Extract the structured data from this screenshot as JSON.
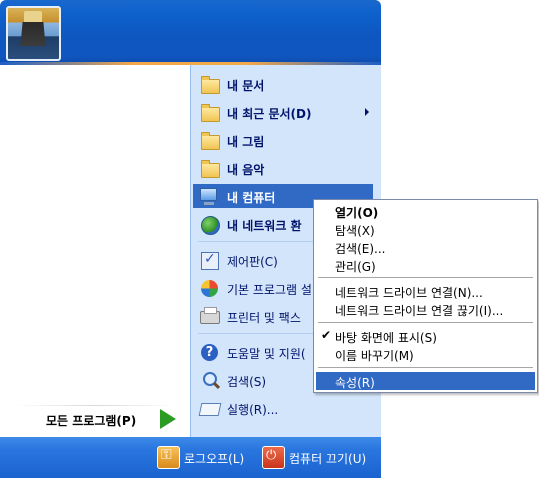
{
  "left_pane": {
    "all_programs_label": "모든 프로그램(P)"
  },
  "right_pane": {
    "items": [
      {
        "label": "내 문서",
        "icon": "folder-documents-icon"
      },
      {
        "label": "내 최근 문서(D)",
        "icon": "folder-recent-icon"
      },
      {
        "label": "내 그림",
        "icon": "folder-pictures-icon"
      },
      {
        "label": "내 음악",
        "icon": "folder-music-icon"
      },
      {
        "label": "내 컴퓨터",
        "icon": "computer-icon"
      },
      {
        "label": "내 네트워크 환",
        "icon": "network-icon"
      },
      {
        "label": "제어판(C)",
        "icon": "control-panel-icon"
      },
      {
        "label": "기본 프로그램 설",
        "icon": "default-programs-icon"
      },
      {
        "label": "프린터 및 팩스",
        "icon": "printer-icon"
      },
      {
        "label": "도움말 및 지원(",
        "icon": "help-icon"
      },
      {
        "label": "검색(S)",
        "icon": "search-icon"
      },
      {
        "label": "실행(R)...",
        "icon": "run-icon"
      }
    ]
  },
  "footer": {
    "logoff_label": "로그오프(L)",
    "shutdown_label": "컴퓨터 끄기(U)"
  },
  "context_menu": {
    "items": [
      {
        "label": "열기(O)",
        "bold": true
      },
      {
        "label": "탐색(X)"
      },
      {
        "label": "검색(E)..."
      },
      {
        "label": "관리(G)"
      },
      {
        "label": "네트워크 드라이브 연결(N)..."
      },
      {
        "label": "네트워크 드라이브 연결 끊기(I)..."
      },
      {
        "label": "바탕 화면에 표시(S)",
        "checked": true
      },
      {
        "label": "이름 바꾸기(M)"
      },
      {
        "label": "속성(R)",
        "selected": true
      }
    ]
  },
  "colors": {
    "header_blue": "#0e60cb",
    "right_pane_bg": "#d3e5fa",
    "selection": "#316ac5",
    "all_programs_arrow": "#2b9b24"
  }
}
